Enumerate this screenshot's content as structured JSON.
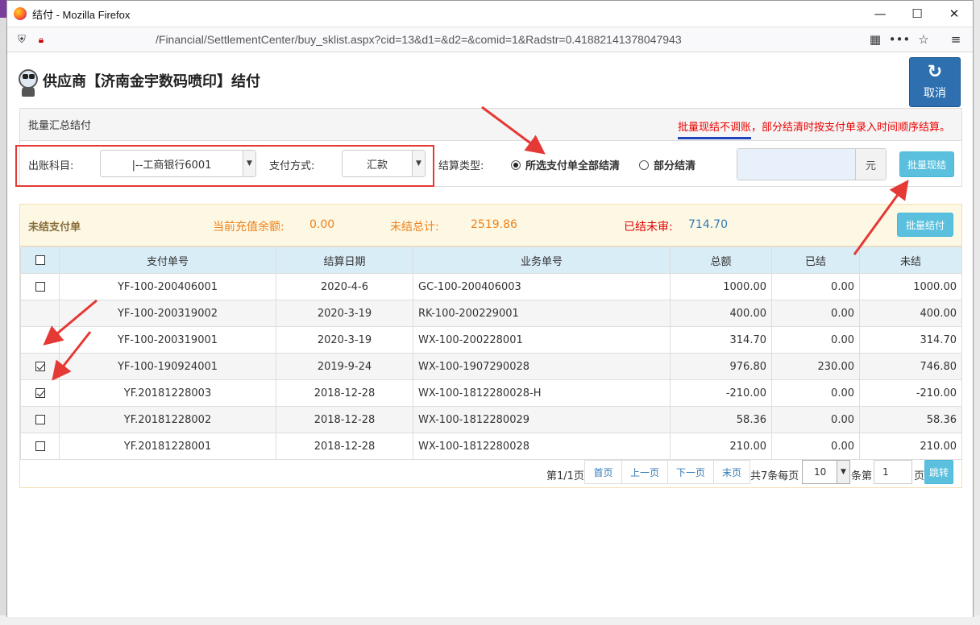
{
  "browser": {
    "window_title": "结付 - Mozilla Firefox",
    "url": "/Financial/SettlementCenter/buy_sklist.aspx?cid=13&d1=&d2=&comid=1&Radstr=0.41882141378047943",
    "icons": [
      "firefox-logo-icon",
      "minimize-icon",
      "maximize-icon",
      "close-icon",
      "shield-icon",
      "connection-insecure-icon",
      "qr-code-icon",
      "more-icon",
      "bookmark-star-icon",
      "menu-icon"
    ]
  },
  "header": {
    "title": "供应商【济南金宇数码喷印】结付",
    "cancel_label": "取消"
  },
  "batch_panel": {
    "heading": "批量汇总结付",
    "notice_highlight": "批量现结不调账",
    "notice_rest": "，部分结清时按支付单录入时间顺序结算。",
    "account_label": "出账科目:",
    "account_value": "|--工商银行6001",
    "method_label": "支付方式:",
    "method_value": "汇款",
    "type_label": "结算类型:",
    "option_all": "所选支付单全部结清",
    "option_partial": "部分结清",
    "selected_option": "all",
    "amount_unit": "元",
    "amount_value": "",
    "batch_cash_label": "批量现结"
  },
  "unsettled_panel": {
    "heading": "未结支付单",
    "balance_label": "当前充值余额:",
    "balance_value": "0.00",
    "total_label": "未结总计:",
    "total_value": "2519.86",
    "unaudited_label": "已结未审:",
    "unaudited_value": "714.70",
    "batch_pay_label": "批量结付",
    "columns": [
      "支付单号",
      "结算日期",
      "业务单号",
      "总额",
      "已结",
      "未结"
    ],
    "rows": [
      {
        "checkbox": "unchecked",
        "pay_no": "YF-100-200406001",
        "date": "2020-4-6",
        "biz_no": "GC-100-200406003",
        "total": "1000.00",
        "settled": "0.00",
        "unsettled": "1000.00"
      },
      {
        "checkbox": "none",
        "pay_no": "YF-100-200319002",
        "date": "2020-3-19",
        "biz_no": "RK-100-200229001",
        "total": "400.00",
        "settled": "0.00",
        "unsettled": "400.00"
      },
      {
        "checkbox": "none",
        "pay_no": "YF-100-200319001",
        "date": "2020-3-19",
        "biz_no": "WX-100-200228001",
        "total": "314.70",
        "settled": "0.00",
        "unsettled": "314.70"
      },
      {
        "checkbox": "checked",
        "pay_no": "YF-100-190924001",
        "date": "2019-9-24",
        "biz_no": "WX-100-1907290028",
        "total": "976.80",
        "settled": "230.00",
        "unsettled": "746.80"
      },
      {
        "checkbox": "checked",
        "pay_no": "YF.20181228003",
        "date": "2018-12-28",
        "biz_no": "WX-100-1812280028-H",
        "total": "-210.00",
        "settled": "0.00",
        "unsettled": "-210.00"
      },
      {
        "checkbox": "unchecked",
        "pay_no": "YF.20181228002",
        "date": "2018-12-28",
        "biz_no": "WX-100-1812280029",
        "total": "58.36",
        "settled": "0.00",
        "unsettled": "58.36"
      },
      {
        "checkbox": "unchecked",
        "pay_no": "YF.20181228001",
        "date": "2018-12-28",
        "biz_no": "WX-100-1812280028",
        "total": "210.00",
        "settled": "0.00",
        "unsettled": "210.00"
      }
    ]
  },
  "pager": {
    "page_info": "第1/1页",
    "first": "首页",
    "prev": "上一页",
    "next": "下一页",
    "last": "末页",
    "count_text": "共7条每页",
    "page_size": "10",
    "goto_prefix": "条第",
    "goto_value": "1",
    "goto_suffix": "页",
    "go_label": "跳转"
  },
  "colors": {
    "accent_blue": "#2e6fb0",
    "info_button": "#5bc0de",
    "link": "#337ab7",
    "orange_text": "#f0801b",
    "red_text": "#e00000",
    "annotation_red": "#e53935"
  }
}
